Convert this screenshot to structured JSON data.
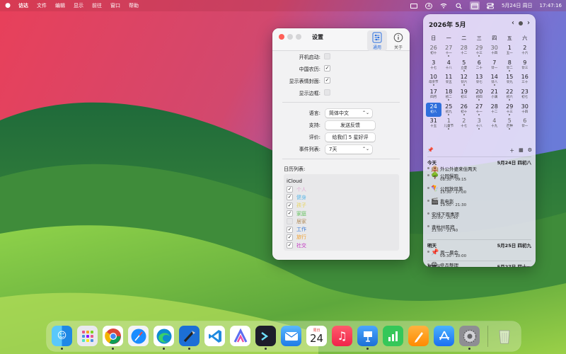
{
  "menubar": {
    "app_name": "访达",
    "items": [
      "文件",
      "编辑",
      "显示",
      "前往",
      "窗口",
      "帮助"
    ],
    "status_icons": [
      "display-icon",
      "input-a-icon",
      "wifi-icon",
      "search-icon",
      "calendar-app-icon",
      "control-center-icon"
    ],
    "input_label": "A",
    "date": "5月24日 周日",
    "time": "17:47:16"
  },
  "settings": {
    "title": "设置",
    "toolbar": {
      "general": "通用",
      "about": "关于"
    },
    "rows": {
      "launch_at_login": "开机启动:",
      "chinese_lunar": "中国农历:",
      "show_emoji_cover": "显示表情封面:",
      "show_border": "显示边框:"
    },
    "language_label": "语言:",
    "language_value": "简体中文",
    "support_label": "支持:",
    "support_button": "发送反馈",
    "rate_label": "评价:",
    "rate_button": "给我们 5 星好评",
    "event_list_label": "事件列表:",
    "event_list_value": "7天",
    "calendar_list_label": "日历列表:",
    "calendar_group": "iCloud",
    "calendars": [
      {
        "name": "个人",
        "color": "#e0a7d4",
        "checked": true
      },
      {
        "name": "健身",
        "color": "#5fb8e8",
        "checked": true
      },
      {
        "name": "孩子",
        "color": "#e8d45a",
        "checked": true
      },
      {
        "name": "家庭",
        "color": "#60c05a",
        "checked": true
      },
      {
        "name": "居家",
        "color": "#b08a58",
        "checked": false
      },
      {
        "name": "工作",
        "color": "#3a7bd5",
        "checked": true
      },
      {
        "name": "旅行",
        "color": "#f0a030",
        "checked": true
      },
      {
        "name": "社交",
        "color": "#c030c0",
        "checked": true
      }
    ]
  },
  "calendar": {
    "month_title": "2026年 5月",
    "weekdays": [
      "日",
      "一",
      "二",
      "三",
      "四",
      "五",
      "六"
    ],
    "weeks": [
      [
        [
          "26",
          "初十"
        ],
        [
          "27",
          "十一"
        ],
        [
          "28",
          "十二"
        ],
        [
          "29",
          "十三"
        ],
        [
          "30",
          "十四"
        ],
        [
          "1",
          "五一"
        ],
        [
          "2",
          "十六"
        ]
      ],
      [
        [
          "3",
          "十七"
        ],
        [
          "4",
          "十八"
        ],
        [
          "5",
          "立夏"
        ],
        [
          "6",
          "二十"
        ],
        [
          "7",
          "廿一"
        ],
        [
          "8",
          "廿二"
        ],
        [
          "9",
          "廿三"
        ]
      ],
      [
        [
          "10",
          "母亲节"
        ],
        [
          "11",
          "廿五"
        ],
        [
          "12",
          "廿六"
        ],
        [
          "13",
          "廿七"
        ],
        [
          "14",
          "廿八"
        ],
        [
          "15",
          "廿九"
        ],
        [
          "16",
          "三十"
        ]
      ],
      [
        [
          "17",
          "四月"
        ],
        [
          "18",
          "初二"
        ],
        [
          "19",
          "初三"
        ],
        [
          "20",
          "初四"
        ],
        [
          "21",
          "小满"
        ],
        [
          "22",
          "初六"
        ],
        [
          "23",
          "初七"
        ]
      ],
      [
        [
          "24",
          "初八"
        ],
        [
          "25",
          "初九"
        ],
        [
          "26",
          "初十"
        ],
        [
          "27",
          "十一"
        ],
        [
          "28",
          "十二"
        ],
        [
          "29",
          "十三"
        ],
        [
          "30",
          "十四"
        ]
      ],
      [
        [
          "31",
          "十五"
        ],
        [
          "1",
          "儿童节"
        ],
        [
          "2",
          "十七"
        ],
        [
          "3",
          "十八"
        ],
        [
          "4",
          "十九"
        ],
        [
          "5",
          "芒种"
        ],
        [
          "6",
          "廿一"
        ]
      ]
    ],
    "today": {
      "label": "今天",
      "date": "5月24日 四初八",
      "events": [
        {
          "emoji": "🏨",
          "title": "外公外婆来住两天",
          "time": ""
        },
        {
          "emoji": "🌳",
          "title": "公园慢跑",
          "time": "08:30 - 09:15"
        },
        {
          "emoji": "🪁",
          "title": "公园放风筝",
          "time": "15:30 - 17:00"
        },
        {
          "emoji": "🎬",
          "title": "看电影",
          "time": "19:00 - 21:30"
        },
        {
          "emoji": "",
          "title": "安排下周事项",
          "time": "20:00 - 20:40"
        },
        {
          "emoji": "",
          "title": "查杭州民宿",
          "time": "21:00 - 21:40"
        }
      ]
    },
    "tomorrow": {
      "label": "明天",
      "date": "5月25日 四初九",
      "events": [
        {
          "emoji": "📌",
          "title": "周一晨会",
          "time": "09:30 - 10:00"
        },
        {
          "emoji": "😊",
          "title": "竞品整理",
          "time": "15:30 - 17:00"
        }
      ]
    },
    "next": {
      "label": "星期三",
      "date": "5月27日 四十一"
    }
  },
  "dock": {
    "calendar_icon_month": "周日",
    "calendar_icon_day": "24",
    "apps": [
      "finder-icon",
      "launchpad-icon",
      "chrome-icon",
      "safari-icon",
      "edge-icon",
      "xcode-icon",
      "vscode-icon",
      "altstore-icon",
      "terminal-icon",
      "mail-icon",
      "calendar-icon",
      "music-icon",
      "keynote-icon",
      "numbers-icon",
      "pages-icon",
      "app-store-icon",
      "system-settings-icon",
      "trash-icon"
    ]
  }
}
